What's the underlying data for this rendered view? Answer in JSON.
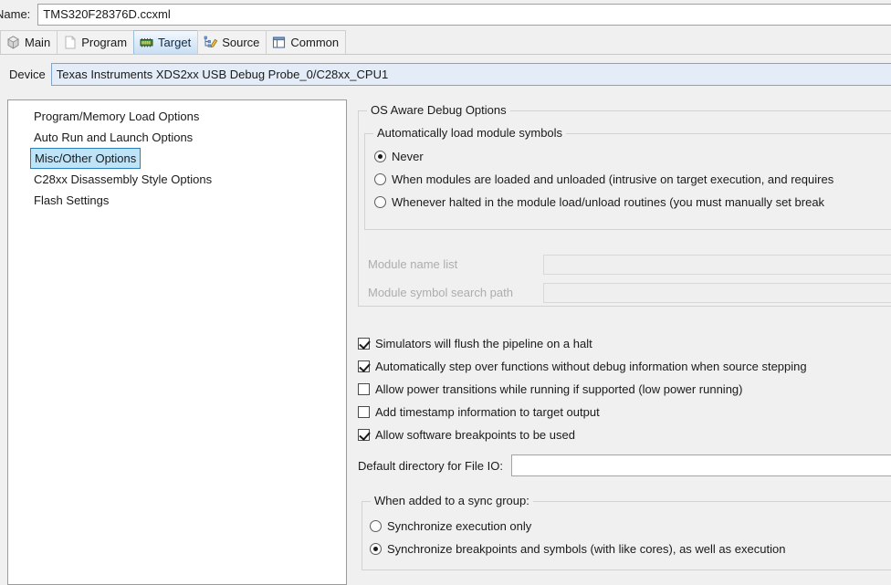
{
  "name_row": {
    "label": "Name:",
    "value": "TMS320F28376D.ccxml"
  },
  "tabs": [
    {
      "label": "Main",
      "icon": "cube-icon",
      "active": false
    },
    {
      "label": "Program",
      "icon": "document-icon",
      "active": false
    },
    {
      "label": "Target",
      "icon": "chip-icon",
      "active": true
    },
    {
      "label": "Source",
      "icon": "source-tree-icon",
      "active": false
    },
    {
      "label": "Common",
      "icon": "window-icon",
      "active": false
    }
  ],
  "device_row": {
    "label": "Device",
    "value": "Texas Instruments XDS2xx USB Debug Probe_0/C28xx_CPU1"
  },
  "tree": {
    "items": [
      {
        "label": "Program/Memory Load Options",
        "selected": false
      },
      {
        "label": "Auto Run and Launch Options",
        "selected": false
      },
      {
        "label": "Misc/Other Options",
        "selected": true
      },
      {
        "label": "C28xx Disassembly Style Options",
        "selected": false
      },
      {
        "label": "Flash Settings",
        "selected": false
      }
    ]
  },
  "os_group": {
    "title": "OS Aware Debug Options",
    "auto_load_group": {
      "title": "Automatically load module symbols",
      "options": [
        {
          "label": "Never",
          "selected": true
        },
        {
          "label": "When modules are loaded and unloaded (intrusive on target execution, and requires",
          "selected": false
        },
        {
          "label": "Whenever halted in the module load/unload routines (you must manually set break",
          "selected": false
        }
      ]
    },
    "fields": [
      {
        "label": "Module name list",
        "value": "",
        "enabled": false
      },
      {
        "label": "Module symbol search path",
        "value": "",
        "enabled": false
      }
    ]
  },
  "checkboxes": [
    {
      "label": "Simulators will flush the pipeline on a halt",
      "checked": true
    },
    {
      "label": "Automatically step over functions without debug information when source stepping",
      "checked": true
    },
    {
      "label": "Allow power transitions while running if supported (low power running)",
      "checked": false
    },
    {
      "label": "Add timestamp information to target output",
      "checked": false
    },
    {
      "label": "Allow software breakpoints to be used",
      "checked": true
    }
  ],
  "file_io": {
    "label": "Default directory for File IO:",
    "value": ""
  },
  "sync_group": {
    "title": "When added to a sync group:",
    "options": [
      {
        "label": "Synchronize execution only",
        "selected": false
      },
      {
        "label": "Synchronize breakpoints and symbols (with like cores), as well as execution",
        "selected": true
      }
    ]
  },
  "colors": {
    "accent": "#2a7fba",
    "selection_fill": "#bfe3f7",
    "device_field": "#e4edf7",
    "panel_bg": "#f0f0f0",
    "disabled_text": "#adadad"
  }
}
